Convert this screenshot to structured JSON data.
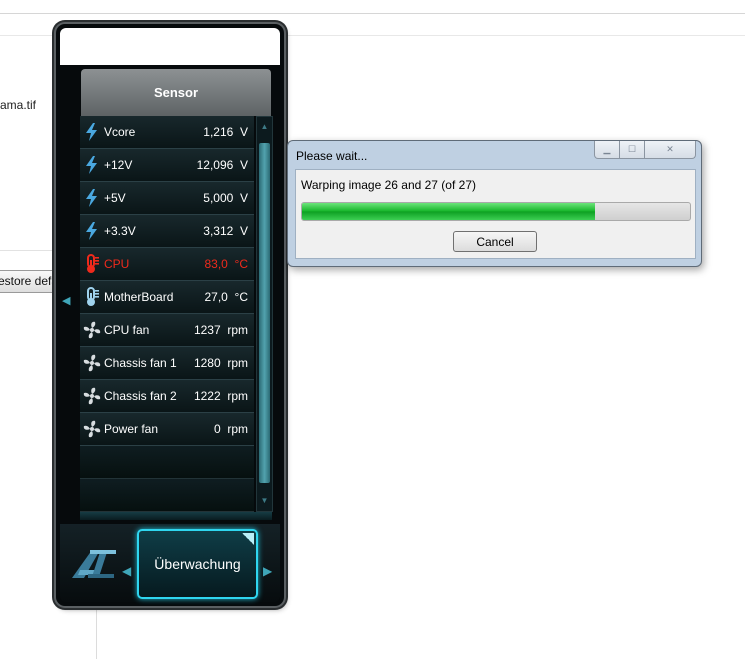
{
  "background_app": {
    "filename_fragment": "ama.tif",
    "restore_button_fragment": "estore defa"
  },
  "gadget": {
    "header": "Sensor",
    "sensors": [
      {
        "icon": "voltage-icon",
        "name": "Vcore",
        "value": "1,216",
        "unit": "V",
        "alert": false
      },
      {
        "icon": "voltage-icon",
        "name": "+12V",
        "value": "12,096",
        "unit": "V",
        "alert": false
      },
      {
        "icon": "voltage-icon",
        "name": "+5V",
        "value": "5,000",
        "unit": "V",
        "alert": false
      },
      {
        "icon": "voltage-icon",
        "name": "+3.3V",
        "value": "3,312",
        "unit": "V",
        "alert": false
      },
      {
        "icon": "thermometer-icon",
        "name": "CPU",
        "value": "83,0",
        "unit": "°C",
        "alert": true
      },
      {
        "icon": "thermometer-icon",
        "name": "MotherBoard",
        "value": "27,0",
        "unit": "°C",
        "alert": false
      },
      {
        "icon": "fan-icon",
        "name": "CPU fan",
        "value": "1237",
        "unit": "rpm",
        "alert": false
      },
      {
        "icon": "fan-icon",
        "name": "Chassis fan 1",
        "value": "1280",
        "unit": "rpm",
        "alert": false
      },
      {
        "icon": "fan-icon",
        "name": "Chassis fan 2",
        "value": "1222",
        "unit": "rpm",
        "alert": false
      },
      {
        "icon": "fan-icon",
        "name": "Power fan",
        "value": "0",
        "unit": "rpm",
        "alert": false
      }
    ],
    "monitor_button": "Überwachung",
    "colors": {
      "normal_text": "#ffffff",
      "alert_text": "#ee2a1c",
      "accent": "#2fd6f0",
      "voltage_icon": "#4aa8e0"
    }
  },
  "dialog": {
    "title": "Please wait...",
    "message": "Warping image 26 and 27 (of 27)",
    "progress_fraction": 0.755,
    "cancel_label": "Cancel",
    "colors": {
      "progress": "#14b428"
    }
  }
}
